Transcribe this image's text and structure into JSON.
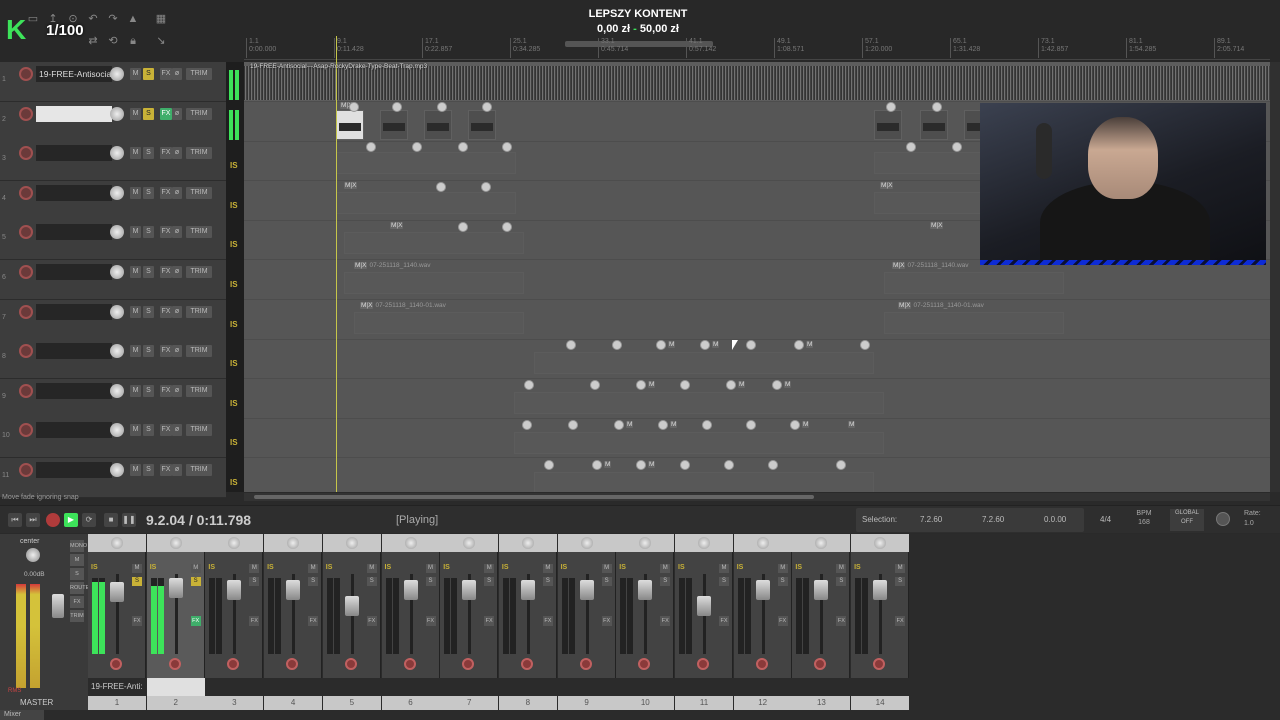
{
  "overlay": {
    "logo": "K",
    "counter": "1/100",
    "donation_title": "LEPSZY KONTENT",
    "donation_current": "0,00 zł",
    "donation_sep": "-",
    "donation_goal": "50,00 zł",
    "donation_progress": 0
  },
  "ruler": {
    "marks": [
      {
        "bar": "1.1",
        "time": "0:00.000"
      },
      {
        "bar": "9.1",
        "time": "0:11.428"
      },
      {
        "bar": "17.1",
        "time": "0:22.857"
      },
      {
        "bar": "25.1",
        "time": "0:34.285"
      },
      {
        "bar": "33.1",
        "time": "0:45.714"
      },
      {
        "bar": "41.1",
        "time": "0:57.142"
      },
      {
        "bar": "49.1",
        "time": "1:08.571"
      },
      {
        "bar": "57.1",
        "time": "1:20.000"
      },
      {
        "bar": "65.1",
        "time": "1:31.428"
      },
      {
        "bar": "73.1",
        "time": "1:42.857"
      },
      {
        "bar": "81.1",
        "time": "1:54.285"
      },
      {
        "bar": "89.1",
        "time": "2:05.714"
      }
    ]
  },
  "tracks": [
    {
      "num": "1",
      "name": "19-FREE-Antisocia",
      "solo": true,
      "fx": false
    },
    {
      "num": "2",
      "name": "",
      "solo": true,
      "fx": true
    },
    {
      "num": "3",
      "name": "",
      "solo": false,
      "fx": false
    },
    {
      "num": "4",
      "name": "",
      "solo": false,
      "fx": false
    },
    {
      "num": "5",
      "name": "",
      "solo": false,
      "fx": false
    },
    {
      "num": "6",
      "name": "",
      "solo": false,
      "fx": false
    },
    {
      "num": "7",
      "name": "",
      "solo": false,
      "fx": false
    },
    {
      "num": "8",
      "name": "",
      "solo": false,
      "fx": false
    },
    {
      "num": "9",
      "name": "",
      "solo": false,
      "fx": false
    },
    {
      "num": "10",
      "name": "",
      "solo": false,
      "fx": false
    },
    {
      "num": "11",
      "name": "",
      "solo": false,
      "fx": false
    }
  ],
  "track_buttons": {
    "m": "M",
    "s": "S",
    "fx": "FX",
    "phase": "ø",
    "trim": "TRIM"
  },
  "meter_label": "IS",
  "arrange": {
    "item_name": "19-FREE-Antisocial---Asap-RockyDrake-Type-Beat-Trap.mp3",
    "mx_label": "M|X",
    "m_label": "M",
    "item_label_a": "07-251118_1140.wav",
    "item_label_b": "07-251118_1140-01.wav"
  },
  "status_line": "Move fade ignoring snap",
  "transport": {
    "position": "9.2.04 / 0:11.798",
    "state": "[Playing]",
    "selection_label": "Selection:",
    "sel_start": "7.2.60",
    "sel_end": "7.2.60",
    "sel_len": "0.0.00",
    "time_sig": "4/4",
    "bpm_label": "BPM",
    "bpm": "168",
    "global_label": "GLOBAL",
    "global_state": "OFF",
    "rate_label": "Rate:",
    "rate": "1.0"
  },
  "mixer": {
    "master_center": "center",
    "master_db": "0.00dB",
    "master_label": "MASTER",
    "master_rms": "RMS",
    "master_buttons": [
      "MONO",
      "M",
      "S",
      "ROUTE",
      "FX",
      "TRIM"
    ],
    "strips": [
      {
        "num": "1",
        "name": "19-FREE-Anti:",
        "solo": true,
        "fx": false,
        "meter": 0.95
      },
      {
        "num": "2",
        "name": "",
        "solo": true,
        "fx": true,
        "meter": 0.9
      },
      {
        "num": "3",
        "name": "",
        "solo": false,
        "fx": false,
        "meter": 0
      },
      {
        "num": "4",
        "name": "",
        "solo": false,
        "fx": false,
        "meter": 0
      },
      {
        "num": "5",
        "name": "",
        "solo": false,
        "fx": false,
        "meter": 0
      },
      {
        "num": "6",
        "name": "",
        "solo": false,
        "fx": false,
        "meter": 0
      },
      {
        "num": "7",
        "name": "",
        "solo": false,
        "fx": false,
        "meter": 0
      },
      {
        "num": "8",
        "name": "",
        "solo": false,
        "fx": false,
        "meter": 0
      },
      {
        "num": "9",
        "name": "",
        "solo": false,
        "fx": false,
        "meter": 0
      },
      {
        "num": "10",
        "name": "",
        "solo": false,
        "fx": false,
        "meter": 0
      },
      {
        "num": "11",
        "name": "",
        "solo": false,
        "fx": false,
        "meter": 0
      },
      {
        "num": "12",
        "name": "",
        "solo": false,
        "fx": false,
        "meter": 0
      },
      {
        "num": "13",
        "name": "",
        "solo": false,
        "fx": false,
        "meter": 0
      },
      {
        "num": "14",
        "name": "",
        "solo": false,
        "fx": false,
        "meter": 0
      }
    ],
    "strip_labels": {
      "is": "IS",
      "m": "M",
      "s": "S",
      "fx": "FX"
    },
    "tab": "Mixer"
  }
}
